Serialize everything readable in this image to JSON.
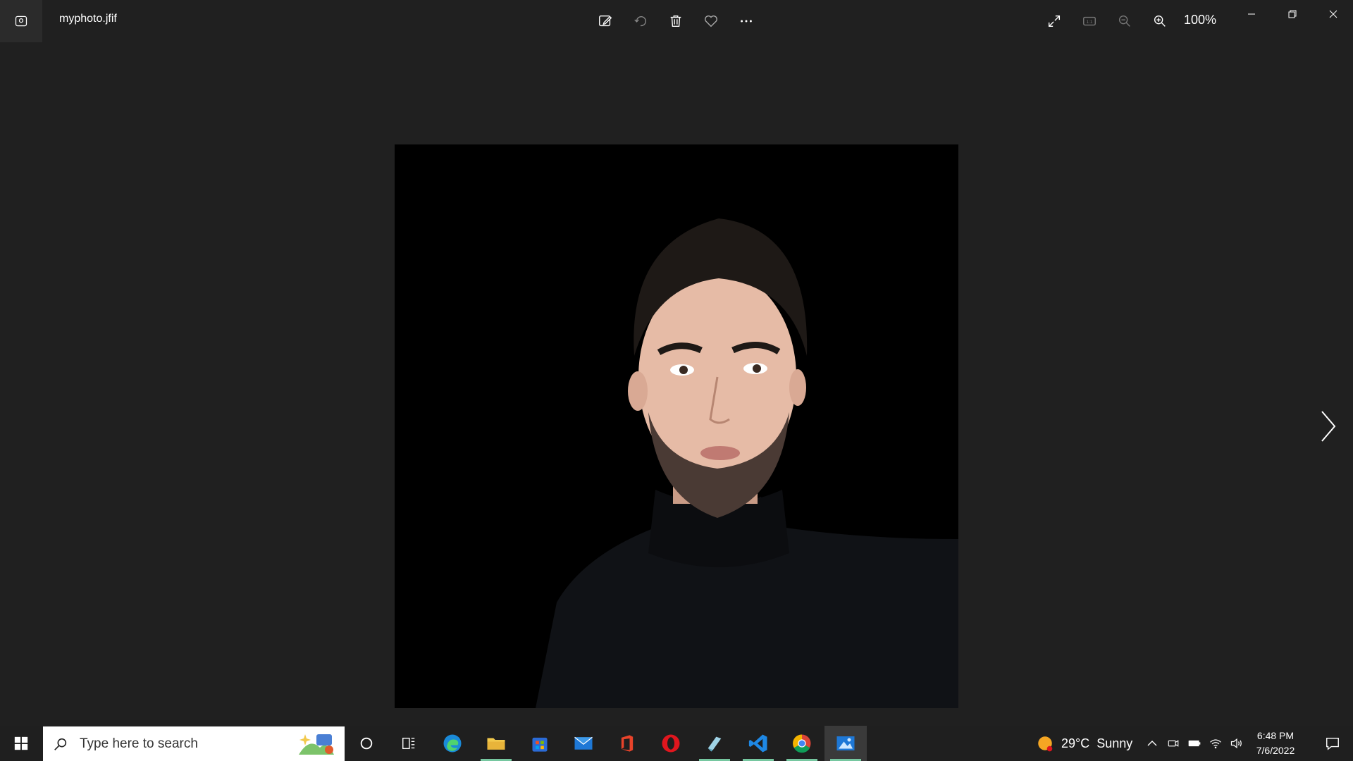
{
  "window": {
    "file_name": "myphoto.jfif",
    "zoom_level": "100%"
  },
  "toolbar": {
    "icons": [
      "edit-icon",
      "rotate-icon",
      "delete-icon",
      "favorite-icon",
      "more-icon"
    ],
    "right_icons": [
      "full-screen-icon",
      "actual-size-icon",
      "zoom-out-icon",
      "zoom-in-icon"
    ]
  },
  "taskbar": {
    "search_placeholder": "Type here to search",
    "apps": [
      "cortana",
      "task-view",
      "edge",
      "file-explorer",
      "microsoft-store",
      "mail",
      "office",
      "opera",
      "notepad",
      "vscode",
      "chrome",
      "photos"
    ],
    "weather": {
      "temp": "29°C",
      "condition": "Sunny"
    },
    "time": "6:48 PM",
    "date": "7/6/2022"
  },
  "colors": {
    "background": "#202020",
    "taskbar": "#1f1f1f",
    "accent_underline": "#76c7a0"
  }
}
